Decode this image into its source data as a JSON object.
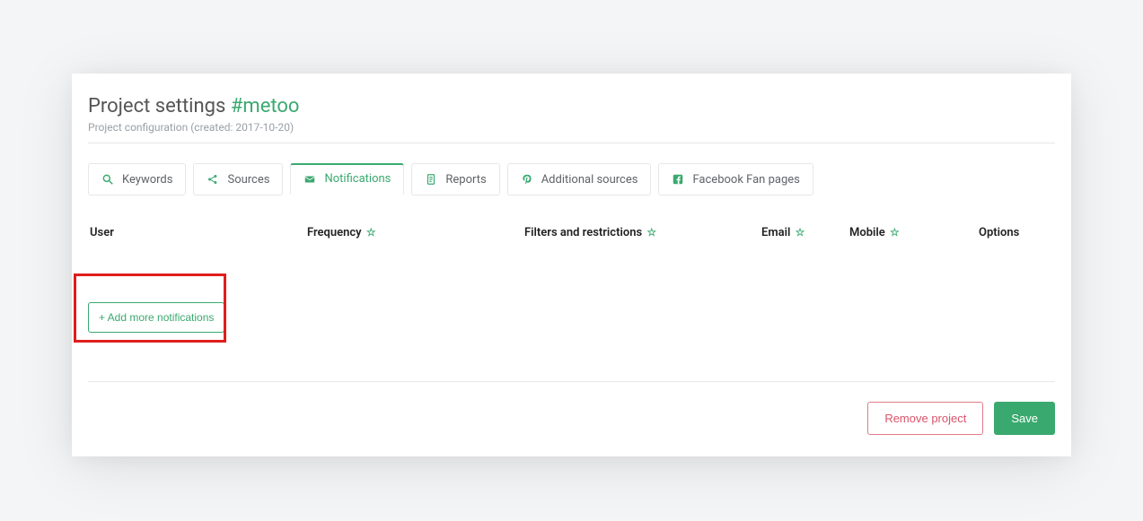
{
  "header": {
    "title_prefix": "Project settings ",
    "title_tag": "#metoo",
    "subtitle": "Project configuration (created: 2017-10-20)"
  },
  "tabs": [
    {
      "label": "Keywords",
      "icon": "search-icon"
    },
    {
      "label": "Sources",
      "icon": "share-icon"
    },
    {
      "label": "Notifications",
      "icon": "mail-icon",
      "active": true
    },
    {
      "label": "Reports",
      "icon": "document-icon"
    },
    {
      "label": "Additional sources",
      "icon": "pinterest-icon"
    },
    {
      "label": "Facebook Fan pages",
      "icon": "facebook-icon"
    }
  ],
  "columns": {
    "user": "User",
    "frequency": "Frequency",
    "filters": "Filters and restrictions",
    "email": "Email",
    "mobile": "Mobile",
    "options": "Options"
  },
  "actions": {
    "add_more": "+ Add more notifications",
    "remove": "Remove project",
    "save": "Save"
  }
}
